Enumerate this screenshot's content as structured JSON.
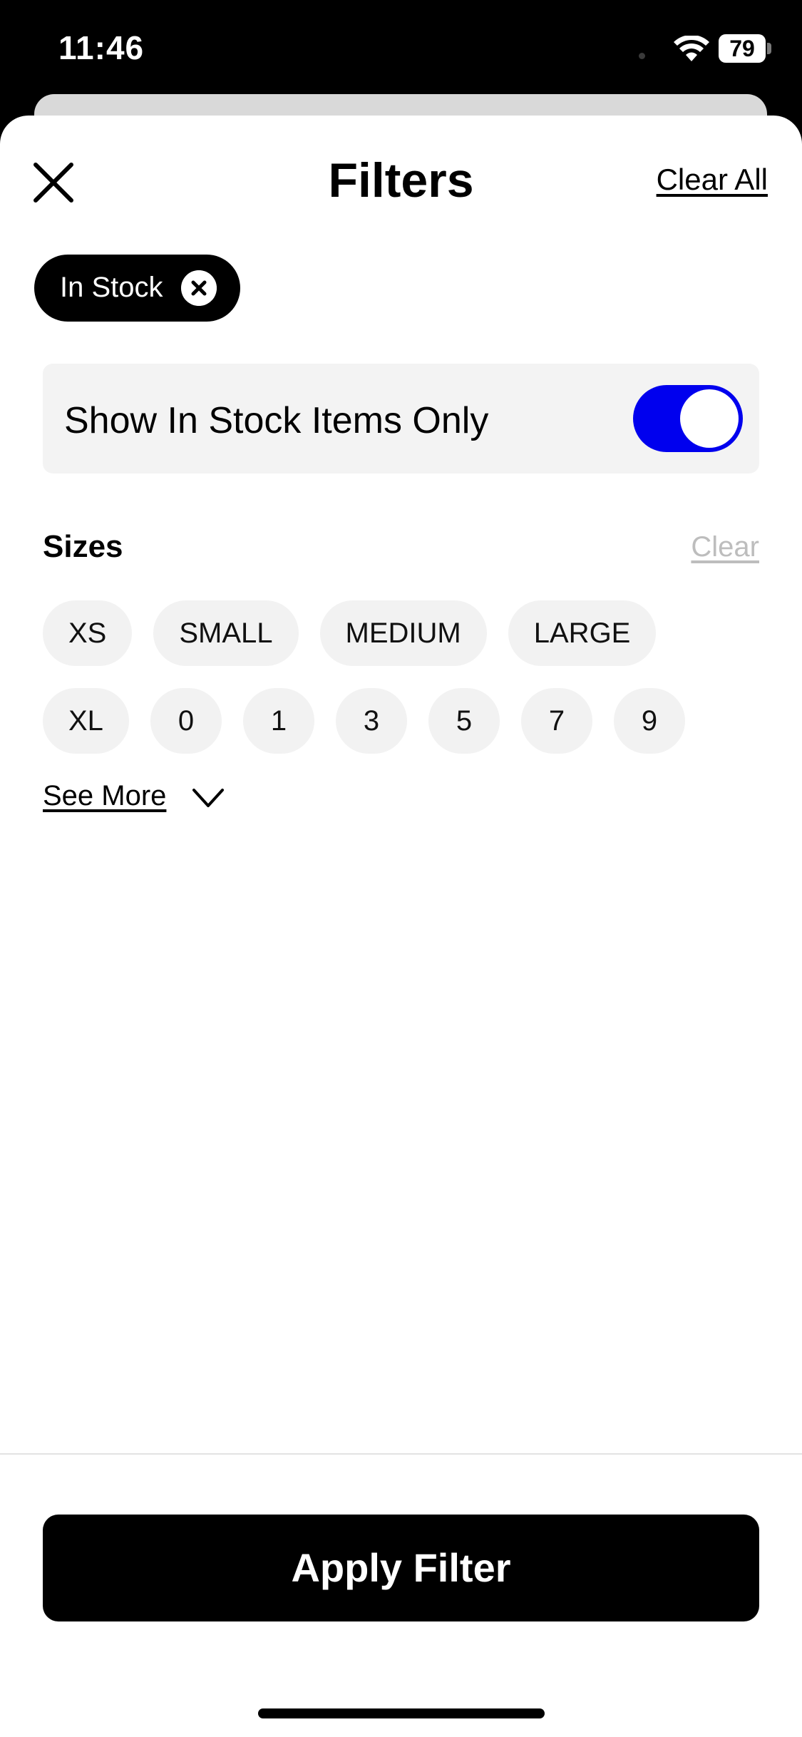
{
  "status_bar": {
    "time": "11:46",
    "battery": "79"
  },
  "header": {
    "title": "Filters",
    "clear_all": "Clear All"
  },
  "active_filters": [
    {
      "label": "In Stock"
    }
  ],
  "in_stock_toggle": {
    "label": "Show In Stock Items Only",
    "on": true,
    "color": "#0000EE"
  },
  "sizes": {
    "heading": "Sizes",
    "clear_label": "Clear",
    "row1": [
      "XS",
      "SMALL",
      "MEDIUM",
      "LARGE"
    ],
    "row2": [
      "XL",
      "0",
      "1",
      "3",
      "5",
      "7",
      "9"
    ],
    "see_more": "See More"
  },
  "footer": {
    "apply_label": "Apply Filter"
  }
}
